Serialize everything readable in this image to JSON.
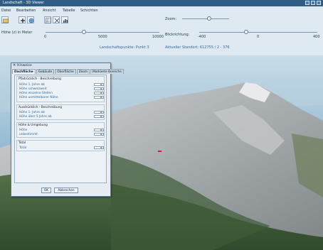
{
  "window": {
    "title": "Landschaft - 3D Viewer"
  },
  "menu": [
    "Datei",
    "Bearbeiten",
    "Ansicht",
    "Tabelle",
    "Schichten"
  ],
  "toolbar": {
    "zoom_label": "Zoom:"
  },
  "controls": {
    "height_label": "Höhe (z) in Meter",
    "height_ticks": [
      "0",
      "5000",
      "10000"
    ],
    "height_value": 0.34,
    "angle_label": "Blickrichtung:",
    "angle_ticks": [
      "-400",
      "0",
      "400"
    ],
    "angle_value": 0.4,
    "zoom_value": 0.58,
    "info_left": "Landschaftspunkte: Punkt 3",
    "info_right": "Aktueller Standort: 612755 / 2 - 376"
  },
  "dialog": {
    "title": "Hinweise",
    "tabs": [
      "Dachfläche",
      "Gebäude",
      "Oberfläche",
      "Zoom",
      "Markierte Bereiche"
    ],
    "sections": [
      {
        "title": "Pfadrücklich - Beschreibung",
        "rows": [
          "Höhe 1. Jahre ab",
          "Höhe schweizweit",
          "Höhe einzelne Stellen",
          "Höhe unmittelbarer Nähe"
        ]
      },
      {
        "title": "Ausdrücklich - Beschreibung",
        "rows": [
          "Höhe 1. Jahre ab",
          "Höhe über 5 Jahre ab"
        ]
      },
      {
        "title": "Höhe & Umgebung",
        "rows": [
          "Höhe",
          "unbestimmt"
        ]
      },
      {
        "title": "Total",
        "rows": [
          "Total"
        ]
      }
    ],
    "ok_label": "OK",
    "cancel_label": "Abbrechen"
  },
  "colors": {
    "titlebar": "#2f5d86",
    "panel": "#dfe9f2",
    "accent_text": "#2b6aa0",
    "marker": "#d6183a"
  }
}
